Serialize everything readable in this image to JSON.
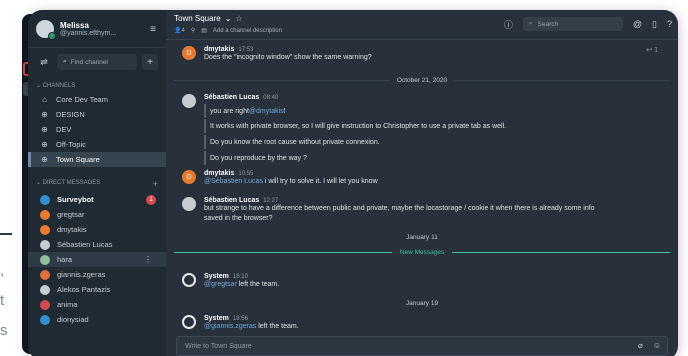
{
  "background": {
    "t1": ",",
    "t2": "t",
    "t3": "s"
  },
  "sidebar": {
    "user": {
      "name": "Melissa",
      "handle": "@yannis.efthym..."
    },
    "find_placeholder": "Find channel",
    "channels_title": "CHANNELS",
    "channels": [
      {
        "label": "Core Dev Team",
        "icon": "lock-icon"
      },
      {
        "label": "DESIGN",
        "icon": "globe-icon"
      },
      {
        "label": "DEV",
        "icon": "globe-icon"
      },
      {
        "label": "Off-Topic",
        "icon": "globe-icon"
      },
      {
        "label": "Town Square",
        "icon": "globe-icon"
      }
    ],
    "dm_title": "DIRECT MESSAGES",
    "dms": [
      {
        "label": "Surveybot",
        "badge": "1",
        "color": "#2f8fd1"
      },
      {
        "label": "gregtsar",
        "color": "#e8792f"
      },
      {
        "label": "dmytakis",
        "color": "#e8792f"
      },
      {
        "label": "Sébastien Lucas",
        "color": "#c6ccd1"
      },
      {
        "label": "hara",
        "color": "#8fc09a"
      },
      {
        "label": "giannis.zgeras",
        "color": "#e06f3b"
      },
      {
        "label": "Alekos Pantazis",
        "color": "#c6ccd1"
      },
      {
        "label": "anima",
        "color": "#d24b4e"
      },
      {
        "label": "dionysiad",
        "color": "#2f8fd1"
      }
    ]
  },
  "topbar": {
    "channel": "Town Square",
    "member_count": "4",
    "description": "Add a channel description",
    "search_placeholder": "Search"
  },
  "posts": {
    "p1": {
      "initial": "D",
      "name": "dmytakis",
      "time": "17:53",
      "text": "Does the \"incognito window\" show the same warning?",
      "reply_count": "1"
    },
    "date1": "October 21, 2020",
    "p2": {
      "name": "Sébastien Lucas",
      "time": "08:40",
      "line1_pre": "you are right ",
      "line1_mention": "@dmytakis",
      "line1_post": " !"
    },
    "c1": "It works with private browser, so I will give instruction to Christopher to use a private tab as well.",
    "c2": "Do you know the root cause without private connexion.",
    "c3": "Do you reproduce by the way ?",
    "p3": {
      "initial": "D",
      "name": "dmytakis",
      "time": "10:55",
      "mention": "@Sébastien Lucas",
      "text": " i will try to solve it. I will let you know"
    },
    "p4": {
      "name": "Sébastien Lucas",
      "time": "12:27",
      "line1": "but strange to have a difference between public and private, maybe the locastorage / cookie it when there is already some info",
      "line2": "saved in the browser?"
    },
    "date2": "January 11",
    "new_messages": "New Messages",
    "p5": {
      "name": "System",
      "time": "18:10",
      "mention": "@gregtsar",
      "text": " left the team."
    },
    "date3": "January 19",
    "p6": {
      "name": "System",
      "time": "18:56",
      "mention": "@giannis.zgeras",
      "text": " left the team."
    }
  },
  "composer": {
    "placeholder": "Write to Town Square"
  }
}
